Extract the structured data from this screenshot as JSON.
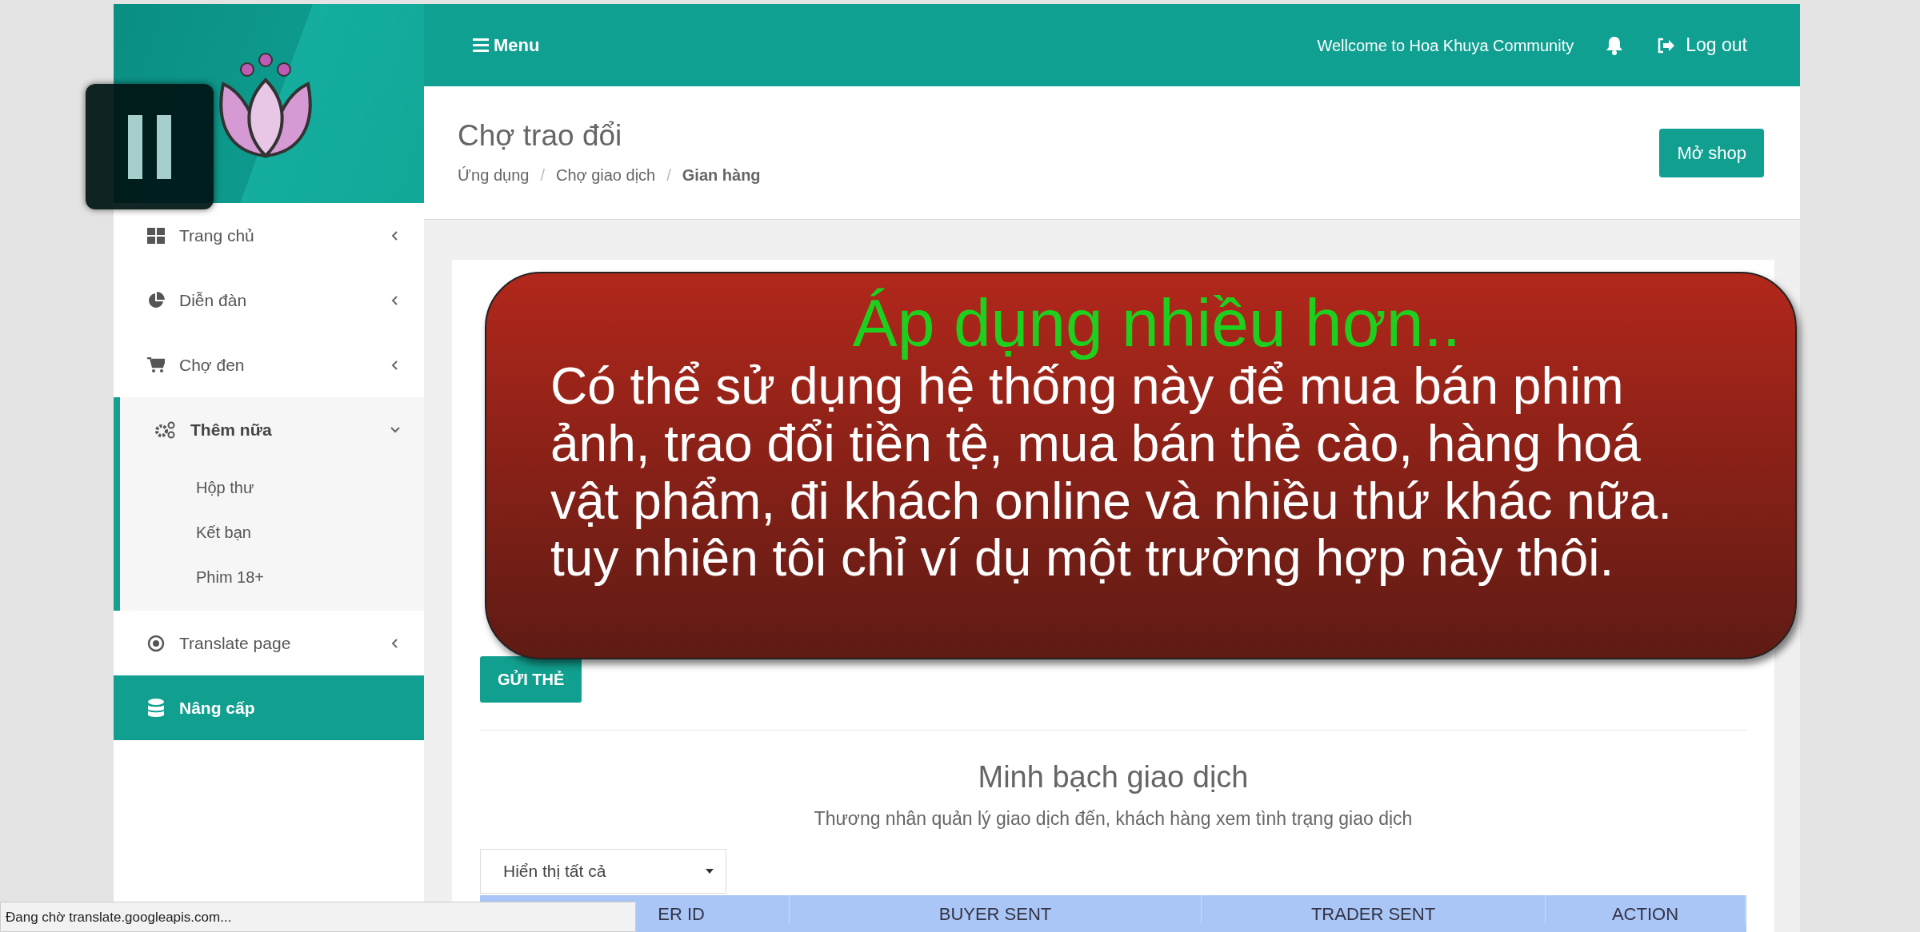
{
  "header": {
    "menu_label": "Menu",
    "welcome": "Wellcome to Hoa Khuya Community",
    "logout": "Log out"
  },
  "sidebar": {
    "items": [
      {
        "label": "Trang chủ",
        "kind": "group",
        "expanded": false,
        "selected": false
      },
      {
        "label": "Diễn đàn",
        "kind": "group",
        "expanded": false,
        "selected": false
      },
      {
        "label": "Chợ đen",
        "kind": "group",
        "expanded": false,
        "selected": false
      },
      {
        "label": "Thêm nữa",
        "kind": "group",
        "expanded": true,
        "selected": false,
        "children": [
          {
            "label": "Hộp thư"
          },
          {
            "label": "Kết bạn"
          },
          {
            "label": "Phim 18+"
          }
        ]
      },
      {
        "label": "Translate page",
        "kind": "group",
        "expanded": false,
        "selected": false
      },
      {
        "label": "Nâng cấp",
        "kind": "link",
        "expanded": false,
        "selected": true
      }
    ]
  },
  "page": {
    "title": "Chợ trao đổi",
    "breadcrumb": [
      {
        "label": "Ứng dụng",
        "current": false
      },
      {
        "separator": "/"
      },
      {
        "label": "Chợ giao dịch",
        "current": false
      },
      {
        "separator": "/"
      },
      {
        "label": "Gian hàng",
        "current": true
      }
    ],
    "action": "Mở shop"
  },
  "card": {
    "submit": "GỬI THẺ",
    "section_title": "Minh bạch giao dịch",
    "section_subtitle": "Thương nhân quản lý giao dịch đến, khách hàng xem tình trạng giao dịch",
    "filter": {
      "value": "Hiển thị tất cả"
    },
    "table": {
      "columns": [
        "ER ID",
        "BUYER SENT",
        "TRADER SENT",
        "ACTION"
      ]
    }
  },
  "callout": {
    "title": "Áp dụng nhiều hơn..",
    "body_lines": [
      "Có thể sử dụng hệ thống này để mua bán phim",
      "ảnh, trao đổi tiền tệ, mua bán thẻ cào, hàng hoá",
      "vật phẩm, đi khách online và nhiều thứ khác nữa.",
      "tuy nhiên tôi chỉ ví dụ một trường hợp này thôi."
    ]
  },
  "status_bar": {
    "text": "Đang chờ translate.googleapis.com..."
  }
}
